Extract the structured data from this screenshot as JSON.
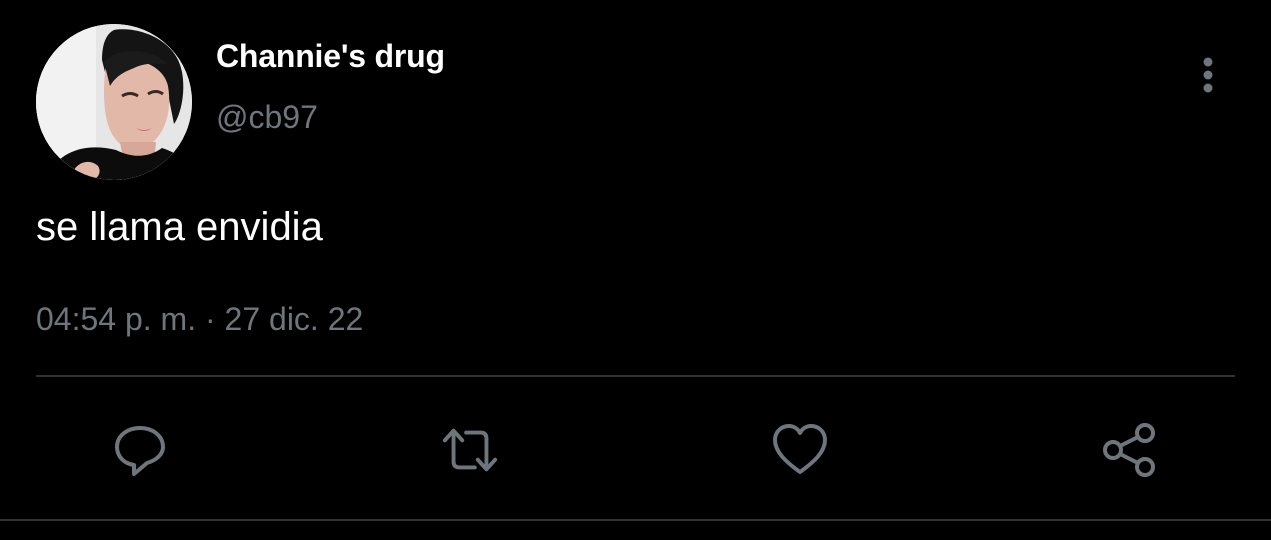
{
  "tweet": {
    "author": {
      "display_name": "Channie's drug",
      "handle": "@cb97",
      "avatar": "profile-photo"
    },
    "text": "se llama envidia",
    "timestamp": "04:54 p. m. · 27 dic. 22"
  },
  "actions": [
    {
      "name": "reply",
      "icon": "reply-icon"
    },
    {
      "name": "retweet",
      "icon": "retweet-icon"
    },
    {
      "name": "like",
      "icon": "heart-icon"
    },
    {
      "name": "share",
      "icon": "share-icon"
    }
  ],
  "colors": {
    "background": "#000000",
    "primary_text": "#ffffff",
    "secondary_text": "#6e767d",
    "divider": "#2f3336",
    "icon": "#6e767d"
  }
}
